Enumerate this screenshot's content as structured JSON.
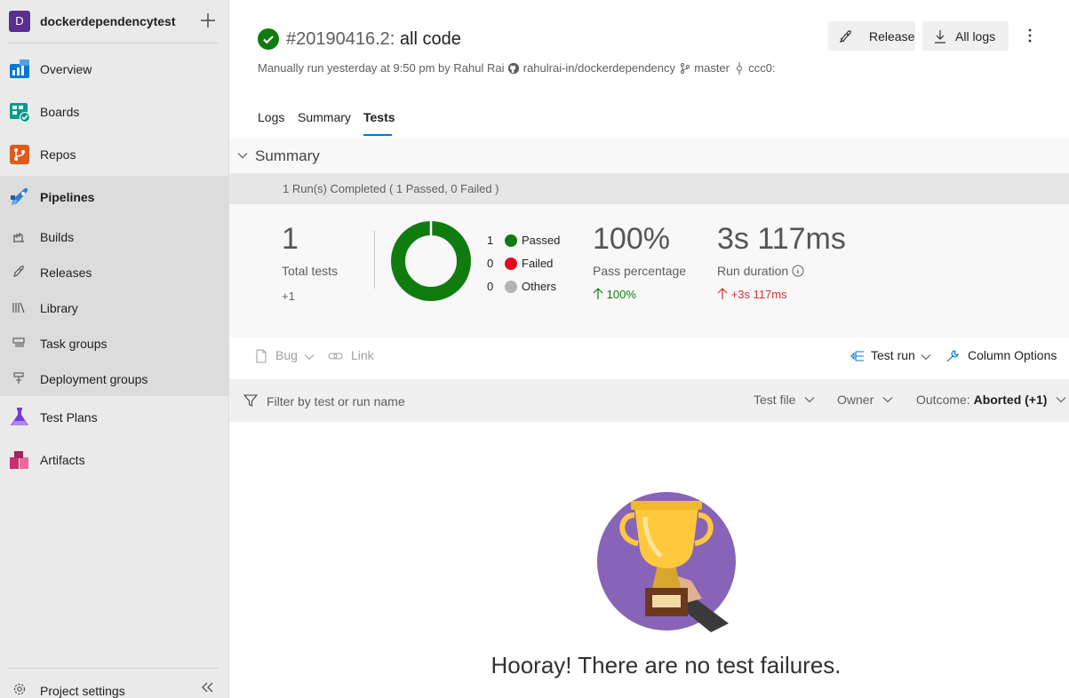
{
  "project": {
    "initial": "D",
    "name": "dockerdependencytest",
    "add_icon": "plus-icon"
  },
  "sidebar": {
    "items": [
      {
        "label": "Overview",
        "icon": "overview-icon"
      },
      {
        "label": "Boards",
        "icon": "boards-icon"
      },
      {
        "label": "Repos",
        "icon": "repos-icon"
      },
      {
        "label": "Pipelines",
        "icon": "pipelines-icon",
        "active": true
      },
      {
        "label": "Test Plans",
        "icon": "test-plans-icon"
      },
      {
        "label": "Artifacts",
        "icon": "artifacts-icon"
      }
    ],
    "pipelines_sub": [
      {
        "label": "Builds",
        "icon": "builds-icon"
      },
      {
        "label": "Releases",
        "icon": "releases-icon"
      },
      {
        "label": "Library",
        "icon": "library-icon"
      },
      {
        "label": "Task groups",
        "icon": "task-groups-icon"
      },
      {
        "label": "Deployment groups",
        "icon": "deployment-groups-icon"
      }
    ],
    "settings_label": "Project settings"
  },
  "header": {
    "run_number": "#20190416.2:",
    "run_name": "all code",
    "meta_prefix": "Manually run yesterday at 9:50 pm by Rahul Rai",
    "repo": "rahulrai-in/dockerdependency",
    "branch": "master",
    "commit": "ccc0:",
    "release_label": "Release",
    "all_logs_label": "All logs"
  },
  "tabs": [
    "Logs",
    "Summary",
    "Tests"
  ],
  "active_tab": "Tests",
  "summary": {
    "title": "Summary",
    "runs_completed": "1 Run(s) Completed ( 1 Passed, 0 Failed )",
    "total_tests": "1",
    "total_tests_label": "Total tests",
    "total_tests_delta": "+1",
    "legend": [
      {
        "count": "1",
        "label": "Passed",
        "color": "#107c10"
      },
      {
        "count": "0",
        "label": "Failed",
        "color": "#e00b1c"
      },
      {
        "count": "0",
        "label": "Others",
        "color": "#b4b4b4"
      }
    ],
    "pass_percentage": "100%",
    "pass_percentage_label": "Pass percentage",
    "pass_percentage_delta": "100%",
    "run_duration": "3s 117ms",
    "run_duration_label": "Run duration",
    "run_duration_delta": "+3s 117ms",
    "delta_up_color": "#107c10",
    "delta_bad_color": "#d13438"
  },
  "toolbar": {
    "bug_label": "Bug",
    "link_label": "Link",
    "test_run_label": "Test run",
    "column_options_label": "Column Options"
  },
  "filter": {
    "placeholder": "Filter by test or run name",
    "test_file_label": "Test file",
    "owner_label": "Owner",
    "outcome_label": "Outcome:",
    "outcome_value": "Aborted (+1)"
  },
  "empty_state": {
    "message": "Hooray! There are no test failures."
  },
  "colors": {
    "accent": "#0078d4",
    "passed": "#107c10",
    "project": "#5c2d91",
    "hero_bg": "#8764b8"
  }
}
